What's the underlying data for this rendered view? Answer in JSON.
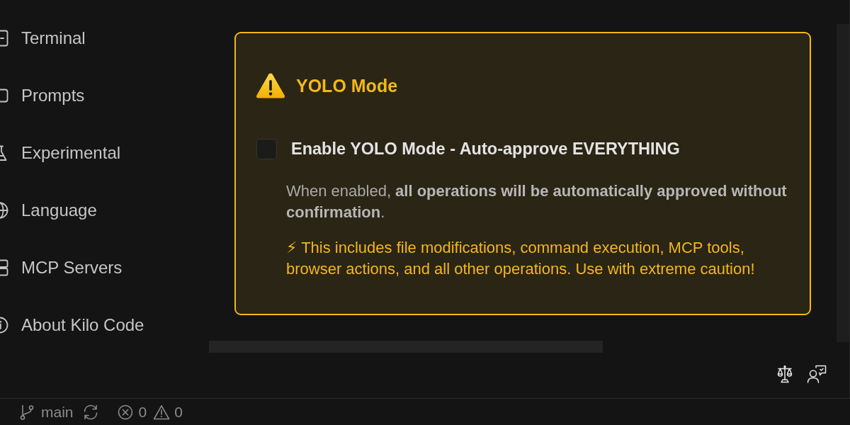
{
  "sidebar": {
    "items": [
      {
        "label": "Terminal"
      },
      {
        "label": "Prompts"
      },
      {
        "label": "Experimental"
      },
      {
        "label": "Language"
      },
      {
        "label": "MCP Servers"
      },
      {
        "label": "About Kilo Code"
      }
    ]
  },
  "yolo_mode": {
    "title": "YOLO Mode",
    "checkbox": {
      "label": "Enable YOLO Mode - Auto-approve EVERYTHING",
      "checked": false
    },
    "description": "When enabled, **all operations will be automatically approved without confirmation**.",
    "warning": "⚡ This includes file modifications, command execution, MCP tools, browser actions, and all other operations. Use with extreme caution!"
  },
  "status_bar": {
    "branch": "main",
    "errors": "0",
    "warnings": "0"
  }
}
